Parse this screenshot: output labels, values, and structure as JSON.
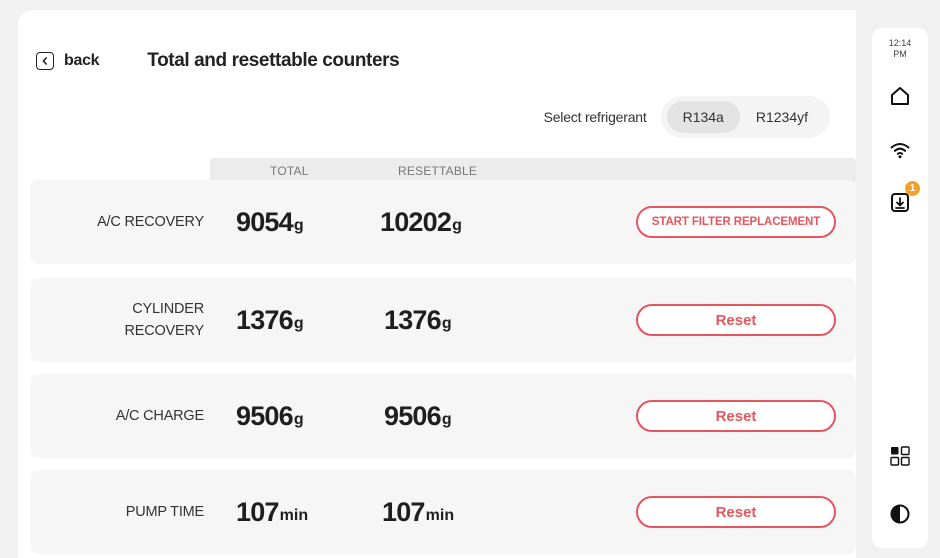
{
  "header": {
    "back_label": "back",
    "title": "Total and resettable counters"
  },
  "refrigerant": {
    "label": "Select refrigerant",
    "options": [
      {
        "label": "R134a",
        "selected": true
      },
      {
        "label": "R1234yf",
        "selected": false
      }
    ]
  },
  "columns": {
    "total": "TOTAL",
    "resettable": "RESETTABLE"
  },
  "rows": [
    {
      "label_line1": "A/C RECOVERY",
      "label_line2": "",
      "total_value": "9054",
      "total_unit": "g",
      "resettable_value": "10202",
      "resettable_unit": "g",
      "action": "START FILTER REPLACEMENT"
    },
    {
      "label_line1": "CYLINDER",
      "label_line2": "RECOVERY",
      "total_value": "1376",
      "total_unit": "g",
      "resettable_value": "1376",
      "resettable_unit": "g",
      "action": "Reset"
    },
    {
      "label_line1": "A/C CHARGE",
      "label_line2": "",
      "total_value": "9506",
      "total_unit": "g",
      "resettable_value": "9506",
      "resettable_unit": "g",
      "action": "Reset"
    },
    {
      "label_line1": "PUMP TIME",
      "label_line2": "",
      "total_value": "107",
      "total_unit": "min",
      "resettable_value": "107",
      "resettable_unit": "min",
      "action": "Reset"
    }
  ],
  "sidebar": {
    "time_line1": "12:14",
    "time_line2": "PM",
    "download_badge": "1",
    "icons": [
      "home-icon",
      "wifi-icon",
      "download-icon",
      "apps-grid-icon",
      "contrast-icon"
    ]
  },
  "colors": {
    "accent": "#e5565f",
    "badge": "#f2a12c",
    "background": "#f1f1f1"
  }
}
